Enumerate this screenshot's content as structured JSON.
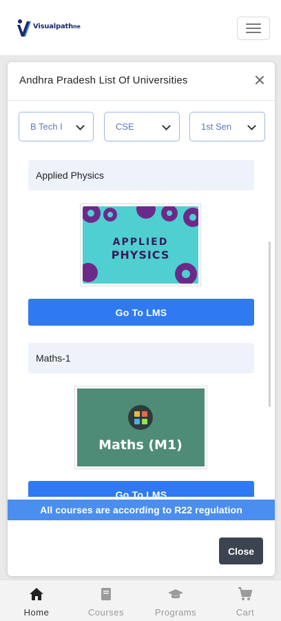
{
  "header": {
    "logo_name": "Visualpath",
    "logo_suffix": "ne",
    "menu_icon": "hamburger-icon"
  },
  "modal": {
    "title": "Andhra Pradesh List Of Universities",
    "close_icon": "close-icon",
    "filters": [
      {
        "value": "B Tech I"
      },
      {
        "value": "CSE"
      },
      {
        "value": "1st Sen"
      }
    ],
    "courses": [
      {
        "title": "Applied Physics",
        "image_line1": "APPLIED",
        "image_line2": "PHYSICS",
        "button": "Go To LMS"
      },
      {
        "title": "Maths-1",
        "image_text": "Maths (M1)",
        "button": "Go To LMS"
      }
    ],
    "notice": "All courses are according to R22 regulation",
    "close_button": "Close"
  },
  "bottom_nav": [
    {
      "label": "Home",
      "icon": "home-icon",
      "active": true
    },
    {
      "label": "Courses",
      "icon": "book-icon",
      "active": false
    },
    {
      "label": "Programs",
      "icon": "graduation-cap-icon",
      "active": false
    },
    {
      "label": "Cart",
      "icon": "cart-icon",
      "active": false
    }
  ],
  "colors": {
    "primary_button": "#2f7af0",
    "notice_bg": "#4a8ef0",
    "close_button": "#3b4450",
    "card_title_bg": "#eef2fb",
    "physics_bg": "#4fcfd0",
    "physics_gear": "#6b2a8a",
    "maths_bg": "#4f8c78"
  }
}
